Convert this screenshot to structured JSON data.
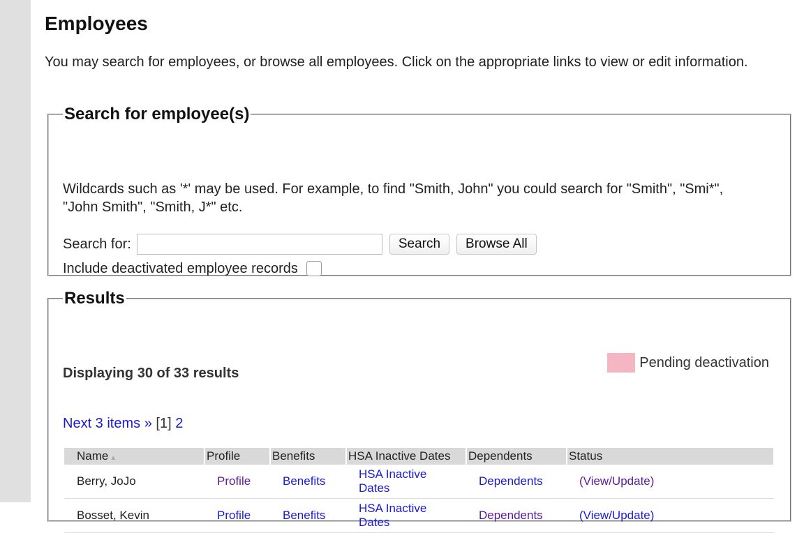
{
  "page": {
    "title": "Employees",
    "intro": "You may search for employees, or browse all employees. Click on the appropriate links to view or edit information."
  },
  "search": {
    "legend": "Search for employee(s)",
    "hint": "Wildcards such as '*' may be used. For example, to find \"Smith, John\" you could search for \"Smith\", \"Smi*\", \"John Smith\", \"Smith, J*\" etc.",
    "label": "Search for:",
    "value": "",
    "search_button": "Search",
    "browse_button": "Browse All",
    "deactivated_label": "Include deactivated employee records",
    "deactivated_checked": false
  },
  "results": {
    "legend": "Results",
    "count_text": "Displaying 30 of 33 results",
    "pending_label": "Pending deactivation",
    "pending_color": "#f4b6c2",
    "pager": {
      "next_label": "Next 3 items »",
      "current_page": "[1]",
      "other_page": "2"
    },
    "columns": {
      "name": "Name",
      "profile": "Profile",
      "benefits": "Benefits",
      "hsa": "HSA Inactive Dates",
      "dependents": "Dependents",
      "status": "Status"
    },
    "rows": [
      {
        "name": "Berry, JoJo",
        "profile": "Profile",
        "benefits": "Benefits",
        "hsa": "HSA Inactive Dates",
        "dependents": "Dependents",
        "status": "(View/Update)"
      },
      {
        "name": "Bosset, Kevin",
        "profile": "Profile",
        "benefits": "Benefits",
        "hsa": "HSA Inactive Dates",
        "dependents": "Dependents",
        "status": "(View/Update)"
      }
    ]
  }
}
